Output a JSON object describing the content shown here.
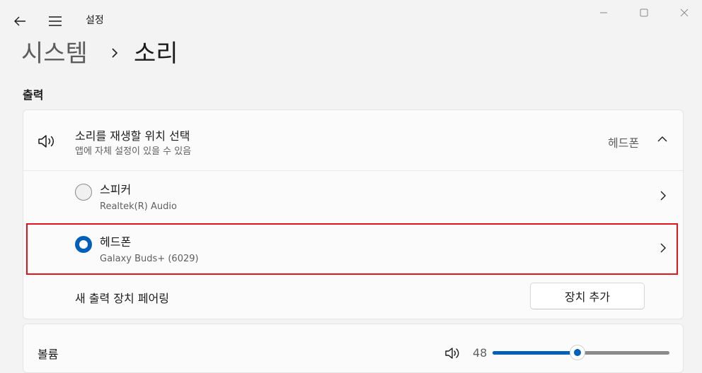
{
  "app": {
    "title": "설정",
    "back_icon": "back-arrow-icon",
    "menu_icon": "hamburger-menu-icon"
  },
  "window_controls": [
    "minimize-icon",
    "maximize-icon",
    "close-icon"
  ],
  "breadcrumb": {
    "parent": "시스템",
    "current": "소리"
  },
  "output": {
    "section_title": "출력",
    "selector": {
      "icon": "speaker-icon",
      "title": "소리를 재생할 위치 선택",
      "subtitle": "앱에 자체 설정이 있을 수 있음",
      "selected_value": "헤드폰",
      "expanded": true
    },
    "devices": [
      {
        "name": "스피커",
        "detail": "Realtek(R) Audio",
        "selected": false
      },
      {
        "name": "헤드폰",
        "detail": "Galaxy Buds+ (6029)",
        "selected": true
      }
    ],
    "pair": {
      "label": "새 출력 장치 페어링",
      "button": "장치 추가"
    }
  },
  "volume": {
    "label": "볼륨",
    "value": "48",
    "level_percent": 48,
    "icon": "speaker-volume-icon"
  },
  "colors": {
    "accent": "#005fb8",
    "highlight": "#e4141b",
    "background": "#f3f3f3",
    "card": "#fbfbfb"
  }
}
